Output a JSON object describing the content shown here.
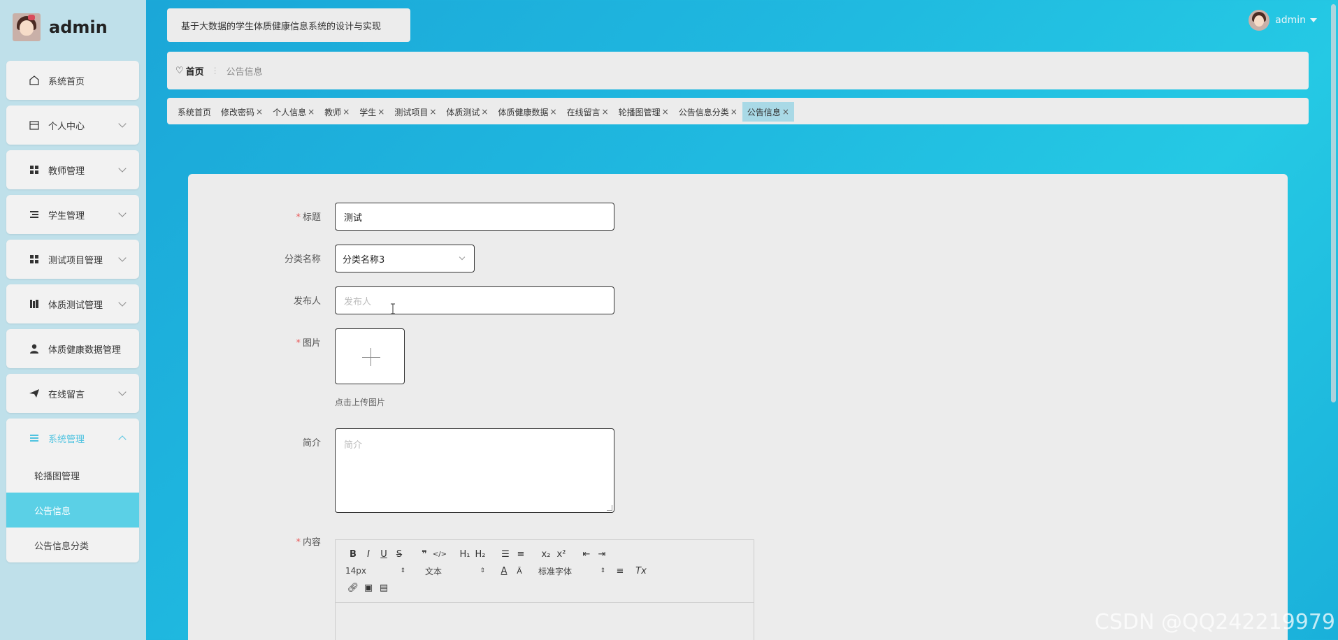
{
  "app": {
    "brand_name": "admin",
    "system_title": "基于大数据的学生体质健康信息系统的设计与实现",
    "user_name": "admin"
  },
  "sidebar": {
    "items": [
      {
        "label": "系统首页",
        "icon": "home-icon"
      },
      {
        "label": "个人中心",
        "icon": "calendar-icon"
      },
      {
        "label": "教师管理",
        "icon": "grid-icon"
      },
      {
        "label": "学生管理",
        "icon": "list-icon"
      },
      {
        "label": "测试项目管理",
        "icon": "grid-icon"
      },
      {
        "label": "体质测试管理",
        "icon": "bar-icon"
      },
      {
        "label": "体质健康数据管理",
        "icon": "user-icon"
      },
      {
        "label": "在线留言",
        "icon": "send-icon"
      }
    ],
    "group": {
      "label": "系统管理",
      "sub_items": [
        "轮播图管理",
        "公告信息",
        "公告信息分类"
      ],
      "active": "公告信息"
    }
  },
  "breadcrumb": {
    "home": "首页",
    "current": "公告信息"
  },
  "tabs": [
    {
      "label": "系统首页",
      "closable": false
    },
    {
      "label": "修改密码",
      "closable": true
    },
    {
      "label": "个人信息",
      "closable": true
    },
    {
      "label": "教师",
      "closable": true
    },
    {
      "label": "学生",
      "closable": true
    },
    {
      "label": "测试项目",
      "closable": true
    },
    {
      "label": "体质测试",
      "closable": true
    },
    {
      "label": "体质健康数据",
      "closable": true
    },
    {
      "label": "在线留言",
      "closable": true
    },
    {
      "label": "轮播图管理",
      "closable": true
    },
    {
      "label": "公告信息分类",
      "closable": true
    },
    {
      "label": "公告信息",
      "closable": true,
      "active": true
    }
  ],
  "form": {
    "title_label": "标题",
    "title_value": "测试",
    "category_label": "分类名称",
    "category_value": "分类名称3",
    "publisher_label": "发布人",
    "publisher_placeholder": "发布人",
    "image_label": "图片",
    "upload_hint": "点击上传图片",
    "intro_label": "简介",
    "intro_placeholder": "简介",
    "content_label": "内容"
  },
  "editor": {
    "font_size": "14px",
    "paragraph": "文本",
    "font_family": "标准字体"
  },
  "watermark": "CSDN @QQ242219979",
  "colors": {
    "accent": "#4fc3e0",
    "active_sub": "#5bd0e6",
    "required": "#e85a5a"
  }
}
